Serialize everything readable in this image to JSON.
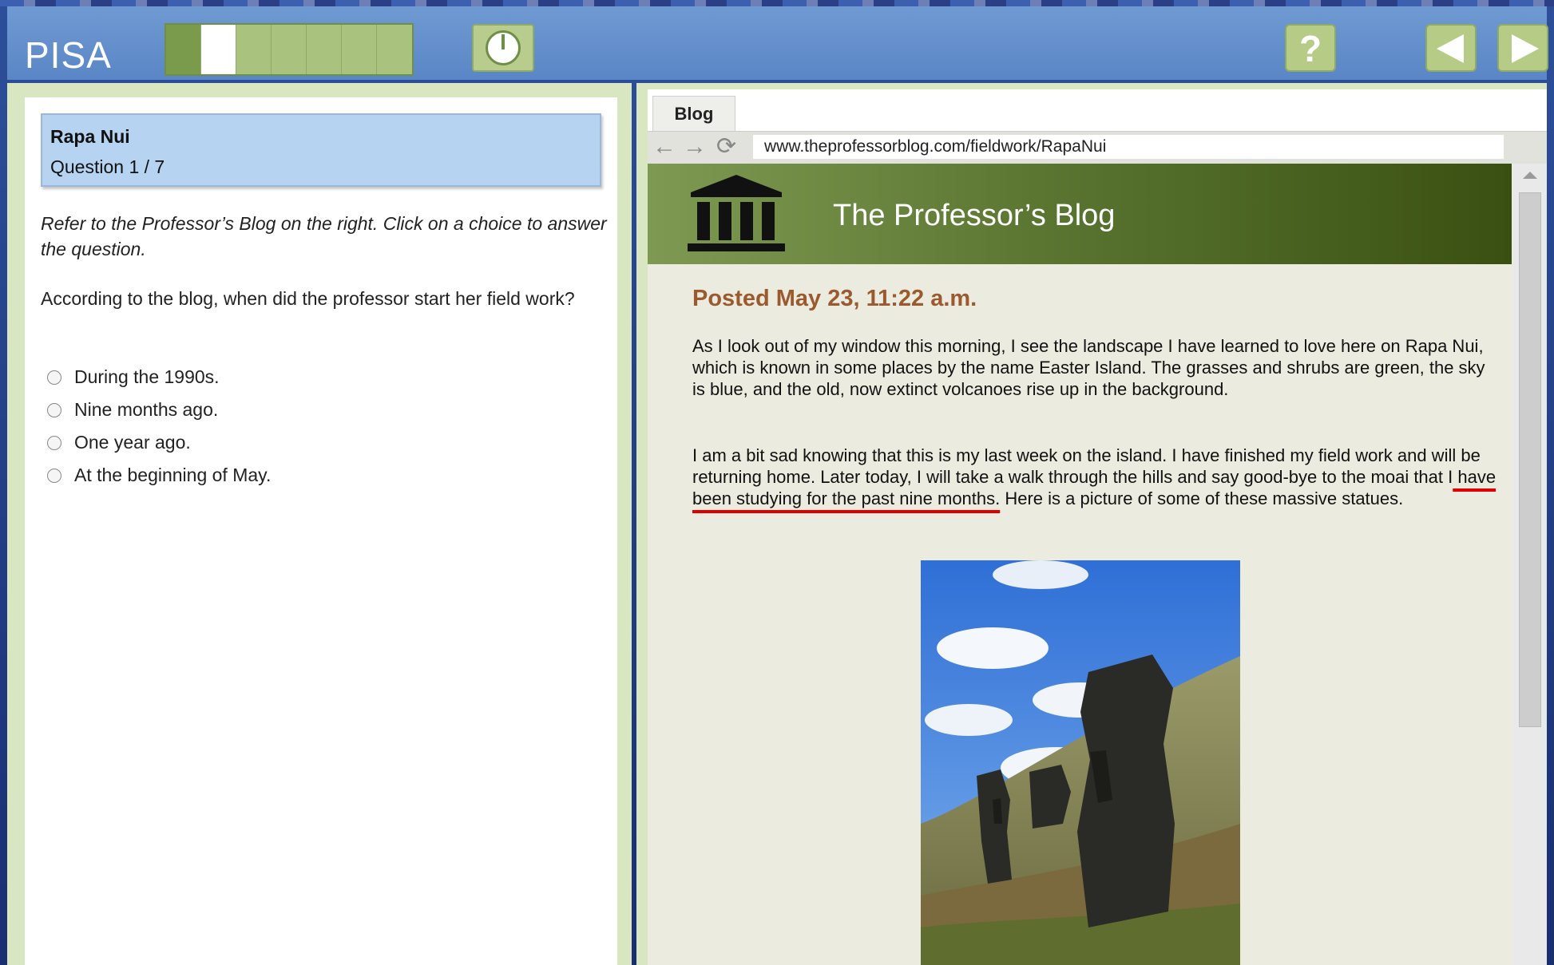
{
  "app": {
    "brand": "PISA"
  },
  "progress": {
    "total_cells": 7,
    "current_index": 1
  },
  "header_buttons": {
    "help_label": "?"
  },
  "question_panel": {
    "unit_title": "Rapa Nui",
    "question_number": "Question 1 / 7",
    "instructions": "Refer to the Professor’s Blog on the right. Click on a choice to answer the question.",
    "question": "According to the blog, when did the professor start her field work?",
    "options": [
      "During the 1990s.",
      "Nine months ago.",
      "One year ago.",
      "At the beginning of May."
    ]
  },
  "browser": {
    "tab_label": "Blog",
    "url": "www.theprofessorblog.com/fieldwork/RapaNui",
    "blog_title": "The Professor’s Blog",
    "post_date": "Posted May 23, 11:22 a.m.",
    "para1": "As I look out of my window this morning, I see the landscape I have learned to love here on Rapa Nui, which is known in some places by the name Easter Island. The grasses and shrubs are green, the sky is blue, and the old, now extinct volcanoes rise up in the background.",
    "para2_before": "I am a bit sad knowing that this is my last week on the island. I have finished my field work and will be returning home. Later today, I will take a walk through the hills and say good-bye to the moai that I",
    "para2_highlight": " have been studying for the past nine months.",
    "para2_after": " Here is a picture of some of these massive statues."
  },
  "colors": {
    "header_blue": "#6f9ad2",
    "panel_green": "#d8e6c2",
    "question_box": "#b6d4f2",
    "post_date": "#9a5a2e",
    "highlight_underline": "#e00000"
  }
}
